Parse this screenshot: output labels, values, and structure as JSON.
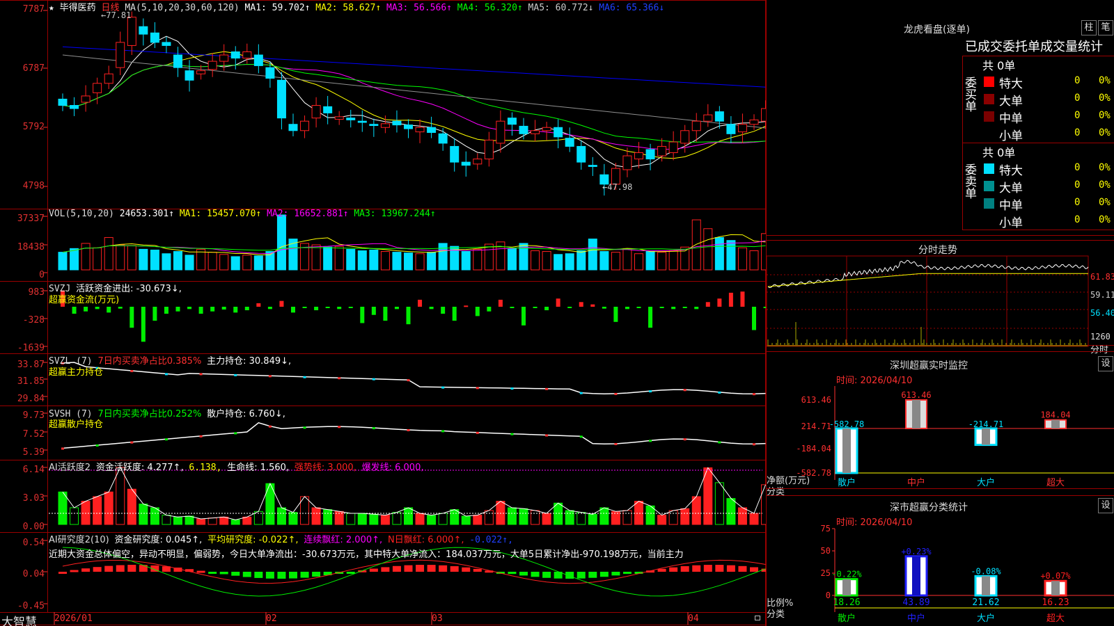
{
  "stock": {
    "star": "★",
    "name": "毕得医药",
    "period": "日线"
  },
  "colors": {
    "up": "#ff2020",
    "down": "#00e0ff",
    "ma1": "#ffffff",
    "ma2": "#ffff00",
    "ma3": "#ff00ff",
    "ma4": "#00ff00",
    "ma5": "#909090",
    "ma6": "#0000ff",
    "green": "#00ee00",
    "grid": "#9a0000"
  },
  "main": {
    "legend": {
      "ma_label": "MA(5,10,20,30,60,120)",
      "ma1": "MA1: 59.702↑",
      "ma2": "MA2: 58.627↑",
      "ma3": "MA3: 56.566↑",
      "ma4": "MA4: 56.320↑",
      "ma5": "MA5: 60.772↓",
      "ma6": "MA6: 65.366↓"
    },
    "y_labels": [
      "7787",
      "6787",
      "5792",
      "4798"
    ],
    "high_note": "←77.81",
    "low_note": "←47.98",
    "ylim": [
      47.0,
      79.0
    ]
  },
  "vol": {
    "legend": {
      "label": "VOL(5,10,20)",
      "value": "24653.301↑",
      "ma1": "MA1: 15457.070↑",
      "ma2": "MA2: 16652.881↑",
      "ma3": "MA3: 13967.244↑"
    },
    "y_labels": [
      "37337",
      "18438",
      "0"
    ]
  },
  "svzj": {
    "legend": {
      "label": "SVZJ",
      "value": "活跃资金进出: -30.673↓,",
      "sub": "超赢资金流(万元)"
    },
    "y_labels": [
      "983",
      "-328",
      "-1639"
    ]
  },
  "svzl": {
    "legend": {
      "label": "SVZL (7)",
      "pct": "7日内买卖净占比0.385%",
      "hold": "主力持仓: 30.849↓,",
      "sub": "超赢主力持仓"
    },
    "y_labels": [
      "33.87",
      "31.85",
      "29.84"
    ]
  },
  "svsh": {
    "legend": {
      "label": "SVSH (7)",
      "pct": "7日内买卖净占比0.252%",
      "hold": "散户持仓: 6.760↓,",
      "sub": "超赢散户持仓"
    },
    "y_labels": [
      "9.73",
      "7.52",
      "5.39"
    ]
  },
  "ai": {
    "legend": {
      "label": "AI活跃度2",
      "act": "资金活跃度: 4.277↑,",
      "v2": "6.138,",
      "life": "生命线: 1.560,",
      "strong": "强势线: 3.000,",
      "burst": "爆发线: 6.000,"
    },
    "y_labels": [
      "6.14",
      "3.03",
      "0.00"
    ]
  },
  "research": {
    "legend": {
      "label": "AI研究度2(10)",
      "r1": "资金研究度: 0.045↑,",
      "r2": "平均研究度: -0.022↑,",
      "r3": "连续飘红: 2.000↑,",
      "r4": "N日飘红: 6.000↑,",
      "r5": "-0.022↑,"
    },
    "y_labels": [
      "0.54",
      "0.04",
      "-0.45"
    ],
    "summary": "近期大资金总体偏空，异动不明显，偏弱势，今日大单净流出：-30.673万元，其中特大单净流入：184.037万元，大单5日累计净出-970.198万元，当前主力"
  },
  "xaxis": {
    "brand": "大智慧",
    "labels": [
      "2026/01",
      "02",
      "03",
      "04"
    ]
  },
  "dragon": {
    "title": "龙虎看盘(逐单)",
    "btn1": "柱",
    "btn2": "笔",
    "stat_title": "已成交委托单成交量统计",
    "buy": {
      "side": "委买单",
      "total": "共 0单",
      "rows": [
        {
          "name": "特大",
          "val": "0",
          "pct": "0%"
        },
        {
          "name": "大单",
          "val": "0",
          "pct": "0%"
        },
        {
          "name": "中单",
          "val": "0",
          "pct": "0%"
        },
        {
          "name": "小单",
          "val": "0",
          "pct": "0%"
        }
      ]
    },
    "sell": {
      "side": "委卖单",
      "total": "共 0单",
      "rows": [
        {
          "name": "特大",
          "val": "0",
          "pct": "0%"
        },
        {
          "name": "大单",
          "val": "0",
          "pct": "0%"
        },
        {
          "name": "中单",
          "val": "0",
          "pct": "0%"
        },
        {
          "name": "小单",
          "val": "0",
          "pct": "0%"
        }
      ]
    }
  },
  "intraday": {
    "title": "分时走势",
    "y_labels": [
      "61.83",
      "59.11",
      "56.40"
    ],
    "vol_label": "1260",
    "bottom_label": "分时"
  },
  "monitor": {
    "title": "深圳超赢实时监控",
    "btn": "设",
    "time": "时间: 2026/04/10",
    "y_labels": [
      "613.46",
      "214.71",
      "-184.04",
      "-582.78"
    ],
    "ylabel": "净额(万元)",
    "xcat": "分类",
    "bars": [
      {
        "cat": "散户",
        "value": -582.78,
        "label": "-582.78"
      },
      {
        "cat": "中户",
        "value": 613.46,
        "label": "613.46"
      },
      {
        "cat": "大户",
        "value": -214.71,
        "label": "-214.71"
      },
      {
        "cat": "超大",
        "value": 184.04,
        "label": "184.04"
      }
    ]
  },
  "classify": {
    "title": "深市超赢分类统计",
    "btn": "设",
    "time": "时间: 2026/04/10",
    "y_labels": [
      "75",
      "50",
      "25",
      "0"
    ],
    "ylabel": "比例%",
    "xcat": "分类",
    "bars": [
      {
        "cat": "散户",
        "value": 18.26,
        "label": "18.26",
        "delta": "-0.22%"
      },
      {
        "cat": "中户",
        "value": 43.89,
        "label": "43.89",
        "delta": "+0.23%"
      },
      {
        "cat": "大户",
        "value": 21.62,
        "label": "21.62",
        "delta": "-0.08%"
      },
      {
        "cat": "超大",
        "value": 16.23,
        "label": "16.23",
        "delta": "+0.07%"
      }
    ]
  }
}
